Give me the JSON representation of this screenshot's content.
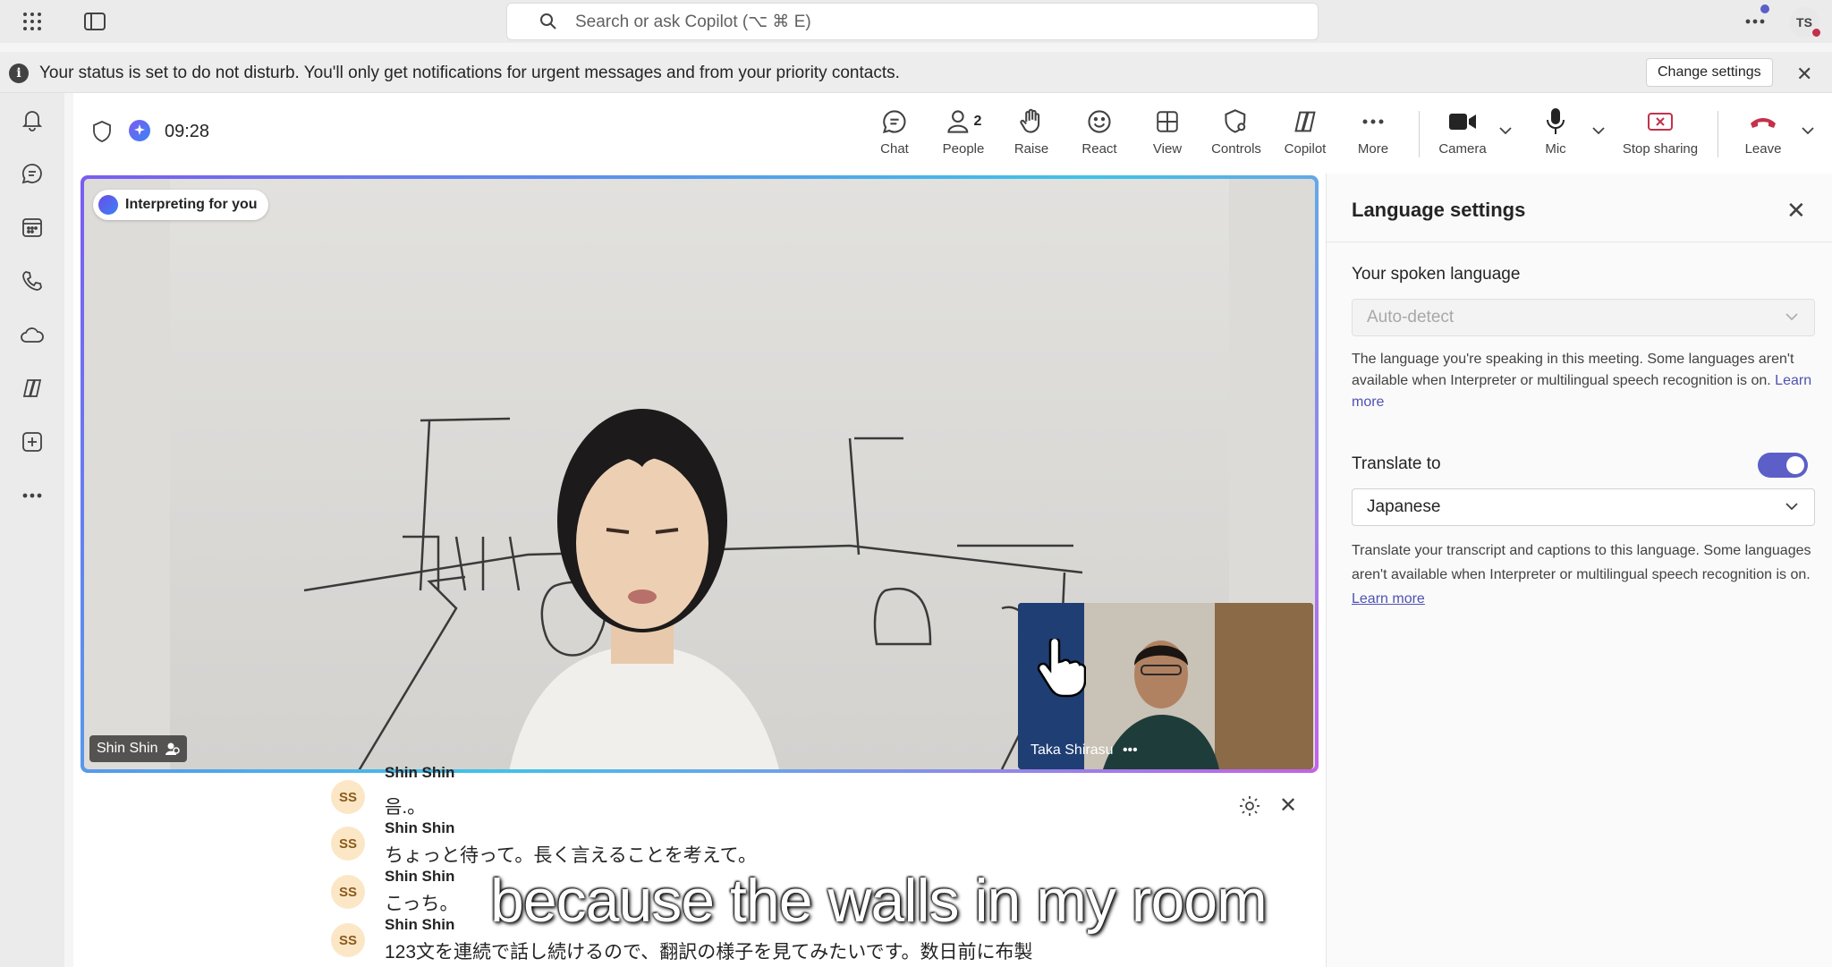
{
  "search": {
    "placeholder": "Search or ask Copilot (⌥ ⌘ E)"
  },
  "account": {
    "initials": "TS"
  },
  "banner": {
    "message": "Your status is set to do not disturb. You'll only get notifications for urgent messages and from your priority contacts.",
    "change_settings": "Change settings"
  },
  "meeting": {
    "timer": "09:28",
    "toolbar": {
      "chat": "Chat",
      "people": "People",
      "people_count": "2",
      "raise": "Raise",
      "react": "React",
      "view": "View",
      "controls": "Controls",
      "copilot": "Copilot",
      "more": "More",
      "camera": "Camera",
      "mic": "Mic",
      "stop_sharing": "Stop sharing",
      "leave": "Leave"
    },
    "badge": "Interpreting for you",
    "main_participant": "Shin Shin",
    "pip_participant": "Taka Shirasu",
    "pip_more": "•••"
  },
  "transcript": {
    "entries": [
      {
        "initials": "SS",
        "name": "Shin Shin",
        "text": "음.。"
      },
      {
        "initials": "SS",
        "name": "Shin Shin",
        "text": "ちょっと待って。長く言えることを考えて。"
      },
      {
        "initials": "SS",
        "name": "Shin Shin",
        "text": "こっち。"
      },
      {
        "initials": "SS",
        "name": "Shin Shin",
        "text": "123文を連続で話し続けるので、翻訳の様子を見てみたいです。数日前に布製"
      }
    ]
  },
  "caption": "because the walls in my room",
  "language_settings": {
    "title": "Language settings",
    "spoken_label": "Your spoken language",
    "spoken_value": "Auto-detect",
    "spoken_help": "The language you're speaking in this meeting. Some languages aren't available when Interpreter or multilingual speech recognition is on.",
    "learn_more": "Learn more",
    "translate_label": "Translate to",
    "translate_enabled": true,
    "translate_value": "Japanese",
    "translate_help": "Translate your transcript and captions to this language. Some languages aren't available when Interpreter or multilingual speech recognition is on.",
    "learn_more_2": "Learn more"
  },
  "colors": {
    "accent": "#5b5fc7",
    "leave": "#c4314b",
    "stop_sharing": "#c4314b"
  }
}
